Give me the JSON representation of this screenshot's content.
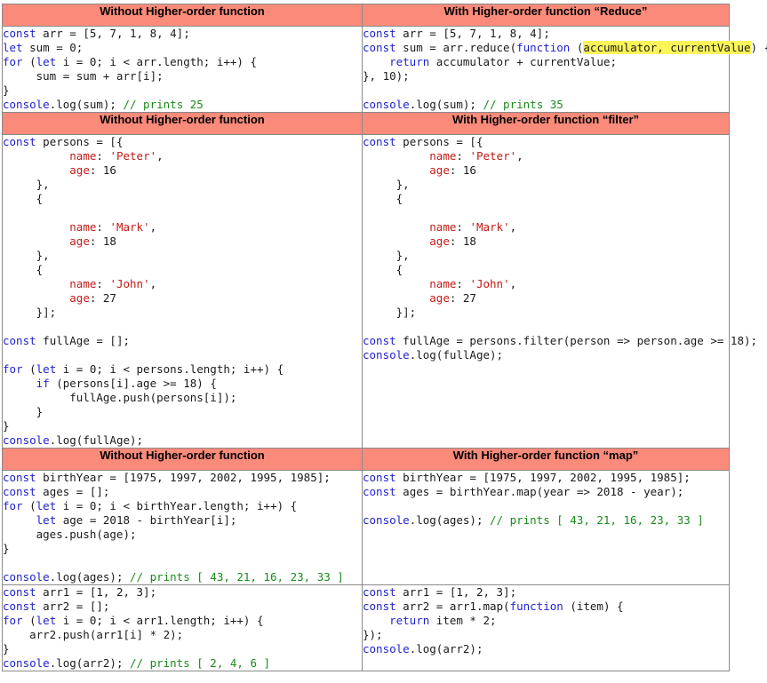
{
  "sections": [
    {
      "left_header": "Without Higher-order function",
      "right_header": "With Higher-order function “Reduce”",
      "left_lines": [
        [
          [
            "kw",
            "const"
          ],
          [
            "p",
            " arr = [5, 7, 1, 8, 4];"
          ]
        ],
        [
          [
            "kw",
            "let"
          ],
          [
            "p",
            " sum = 0;"
          ]
        ],
        [
          [
            "kw",
            "for"
          ],
          [
            "p",
            " ("
          ],
          [
            "kw",
            "let"
          ],
          [
            "p",
            " i = 0; i < arr.length; i++) {"
          ]
        ],
        [
          [
            "p",
            "     sum = sum + arr[i];"
          ]
        ],
        [
          [
            "p",
            "}"
          ]
        ],
        [
          [
            "kw",
            "console"
          ],
          [
            "p",
            ".log(sum); "
          ],
          [
            "cm",
            "// prints 25"
          ]
        ]
      ],
      "right_lines": [
        [
          [
            "kw",
            "const"
          ],
          [
            "p",
            " arr = [5, 7, 1, 8, 4];"
          ]
        ],
        [
          [
            "kw",
            "const"
          ],
          [
            "p",
            " sum = arr.reduce("
          ],
          [
            "kw",
            "function"
          ],
          [
            "p",
            " ("
          ],
          [
            "hl",
            "accumulator, currentValue"
          ],
          [
            "p",
            ") {"
          ]
        ],
        [
          [
            "p",
            "    "
          ],
          [
            "kw",
            "return"
          ],
          [
            "p",
            " accumulator + currentValue;"
          ]
        ],
        [
          [
            "p",
            "}, 10);"
          ]
        ],
        [
          [
            "p",
            ""
          ]
        ],
        [
          [
            "kw",
            "console"
          ],
          [
            "p",
            ".log(sum); "
          ],
          [
            "cm",
            "// prints 35"
          ]
        ]
      ]
    },
    {
      "left_header": "Without Higher-order function",
      "right_header": "With Higher-order function “filter”",
      "left_lines": [
        [
          [
            "kw",
            "const"
          ],
          [
            "p",
            " persons = [{"
          ]
        ],
        [
          [
            "p",
            "          "
          ],
          [
            "pr",
            "name"
          ],
          [
            "p",
            ": "
          ],
          [
            "st",
            "'Peter'"
          ],
          [
            "p",
            ","
          ]
        ],
        [
          [
            "p",
            "          "
          ],
          [
            "pr",
            "age"
          ],
          [
            "p",
            ": 16"
          ]
        ],
        [
          [
            "p",
            "     },"
          ]
        ],
        [
          [
            "p",
            "     {"
          ]
        ],
        [
          [
            "p",
            ""
          ]
        ],
        [
          [
            "p",
            "          "
          ],
          [
            "pr",
            "name"
          ],
          [
            "p",
            ": "
          ],
          [
            "st",
            "'Mark'"
          ],
          [
            "p",
            ","
          ]
        ],
        [
          [
            "p",
            "          "
          ],
          [
            "pr",
            "age"
          ],
          [
            "p",
            ": 18"
          ]
        ],
        [
          [
            "p",
            "     },"
          ]
        ],
        [
          [
            "p",
            "     {"
          ]
        ],
        [
          [
            "p",
            "          "
          ],
          [
            "pr",
            "name"
          ],
          [
            "p",
            ": "
          ],
          [
            "st",
            "'John'"
          ],
          [
            "p",
            ","
          ]
        ],
        [
          [
            "p",
            "          "
          ],
          [
            "pr",
            "age"
          ],
          [
            "p",
            ": 27"
          ]
        ],
        [
          [
            "p",
            "     }];"
          ]
        ],
        [
          [
            "p",
            ""
          ]
        ],
        [
          [
            "kw",
            "const"
          ],
          [
            "p",
            " fullAge = [];"
          ]
        ],
        [
          [
            "p",
            ""
          ]
        ],
        [
          [
            "kw",
            "for"
          ],
          [
            "p",
            " ("
          ],
          [
            "kw",
            "let"
          ],
          [
            "p",
            " i = 0; i < persons.length; i++) {"
          ]
        ],
        [
          [
            "p",
            "     "
          ],
          [
            "kw",
            "if"
          ],
          [
            "p",
            " (persons[i].age >= 18) {"
          ]
        ],
        [
          [
            "p",
            "          fullAge.push(persons[i]);"
          ]
        ],
        [
          [
            "p",
            "     }"
          ]
        ],
        [
          [
            "p",
            "}"
          ]
        ],
        [
          [
            "kw",
            "console"
          ],
          [
            "p",
            ".log(fullAge);"
          ]
        ]
      ],
      "right_lines": [
        [
          [
            "kw",
            "const"
          ],
          [
            "p",
            " persons = [{"
          ]
        ],
        [
          [
            "p",
            "          "
          ],
          [
            "pr",
            "name"
          ],
          [
            "p",
            ": "
          ],
          [
            "st",
            "'Peter'"
          ],
          [
            "p",
            ","
          ]
        ],
        [
          [
            "p",
            "          "
          ],
          [
            "pr",
            "age"
          ],
          [
            "p",
            ": 16"
          ]
        ],
        [
          [
            "p",
            "     },"
          ]
        ],
        [
          [
            "p",
            "     {"
          ]
        ],
        [
          [
            "p",
            ""
          ]
        ],
        [
          [
            "p",
            "          "
          ],
          [
            "pr",
            "name"
          ],
          [
            "p",
            ": "
          ],
          [
            "st",
            "'Mark'"
          ],
          [
            "p",
            ","
          ]
        ],
        [
          [
            "p",
            "          "
          ],
          [
            "pr",
            "age"
          ],
          [
            "p",
            ": 18"
          ]
        ],
        [
          [
            "p",
            "     },"
          ]
        ],
        [
          [
            "p",
            "     {"
          ]
        ],
        [
          [
            "p",
            "          "
          ],
          [
            "pr",
            "name"
          ],
          [
            "p",
            ": "
          ],
          [
            "st",
            "'John'"
          ],
          [
            "p",
            ","
          ]
        ],
        [
          [
            "p",
            "          "
          ],
          [
            "pr",
            "age"
          ],
          [
            "p",
            ": 27"
          ]
        ],
        [
          [
            "p",
            "     }];"
          ]
        ],
        [
          [
            "p",
            ""
          ]
        ],
        [
          [
            "kw",
            "const"
          ],
          [
            "p",
            " fullAge = persons.filter(person => person.age >= 18);"
          ]
        ],
        [
          [
            "kw",
            "console"
          ],
          [
            "p",
            ".log(fullAge);"
          ]
        ]
      ]
    },
    {
      "left_header": "Without Higher-order function",
      "right_header": "With Higher-order function “map”",
      "left_lines": [
        [
          [
            "kw",
            "const"
          ],
          [
            "p",
            " birthYear = [1975, 1997, 2002, 1995, 1985];"
          ]
        ],
        [
          [
            "kw",
            "const"
          ],
          [
            "p",
            " ages = [];"
          ]
        ],
        [
          [
            "kw",
            "for"
          ],
          [
            "p",
            " ("
          ],
          [
            "kw",
            "let"
          ],
          [
            "p",
            " i = 0; i < birthYear.length; i++) {"
          ]
        ],
        [
          [
            "p",
            "     "
          ],
          [
            "kw",
            "let"
          ],
          [
            "p",
            " age = 2018 - birthYear[i];"
          ]
        ],
        [
          [
            "p",
            "     ages.push(age);"
          ]
        ],
        [
          [
            "p",
            "}"
          ]
        ],
        [
          [
            "p",
            ""
          ]
        ],
        [
          [
            "kw",
            "console"
          ],
          [
            "p",
            ".log(ages); "
          ],
          [
            "cm",
            "// prints [ 43, 21, 16, 23, 33 ]"
          ]
        ]
      ],
      "right_lines": [
        [
          [
            "kw",
            "const"
          ],
          [
            "p",
            " birthYear = [1975, 1997, 2002, 1995, 1985];"
          ]
        ],
        [
          [
            "kw",
            "const"
          ],
          [
            "p",
            " ages = birthYear.map(year => 2018 - year);"
          ]
        ],
        [
          [
            "p",
            ""
          ]
        ],
        [
          [
            "kw",
            "console"
          ],
          [
            "p",
            ".log(ages); "
          ],
          [
            "cm",
            "// prints [ 43, 21, 16, 23, 33 ]"
          ]
        ]
      ]
    },
    {
      "left_header": "",
      "right_header": "",
      "left_lines": [
        [
          [
            "kw",
            "const"
          ],
          [
            "p",
            " arr1 = [1, 2, 3];"
          ]
        ],
        [
          [
            "kw",
            "const"
          ],
          [
            "p",
            " arr2 = [];"
          ]
        ],
        [
          [
            "kw",
            "for"
          ],
          [
            "p",
            " ("
          ],
          [
            "kw",
            "let"
          ],
          [
            "p",
            " i = 0; i < arr1.length; i++) {"
          ]
        ],
        [
          [
            "p",
            "    arr2.push(arr1[i] * 2);"
          ]
        ],
        [
          [
            "p",
            "}"
          ]
        ],
        [
          [
            "kw",
            "console"
          ],
          [
            "p",
            ".log(arr2); "
          ],
          [
            "cm",
            "// prints [ 2, 4, 6 ]"
          ]
        ]
      ],
      "right_lines": [
        [
          [
            "kw",
            "const"
          ],
          [
            "p",
            " arr1 = [1, 2, 3];"
          ]
        ],
        [
          [
            "kw",
            "const"
          ],
          [
            "p",
            " arr2 = arr1.map("
          ],
          [
            "kw",
            "function"
          ],
          [
            "p",
            " (item) {"
          ]
        ],
        [
          [
            "p",
            "    "
          ],
          [
            "kw",
            "return"
          ],
          [
            "p",
            " item * 2;"
          ]
        ],
        [
          [
            "p",
            "});"
          ]
        ],
        [
          [
            "kw",
            "console"
          ],
          [
            "p",
            ".log(arr2);"
          ]
        ]
      ]
    }
  ]
}
